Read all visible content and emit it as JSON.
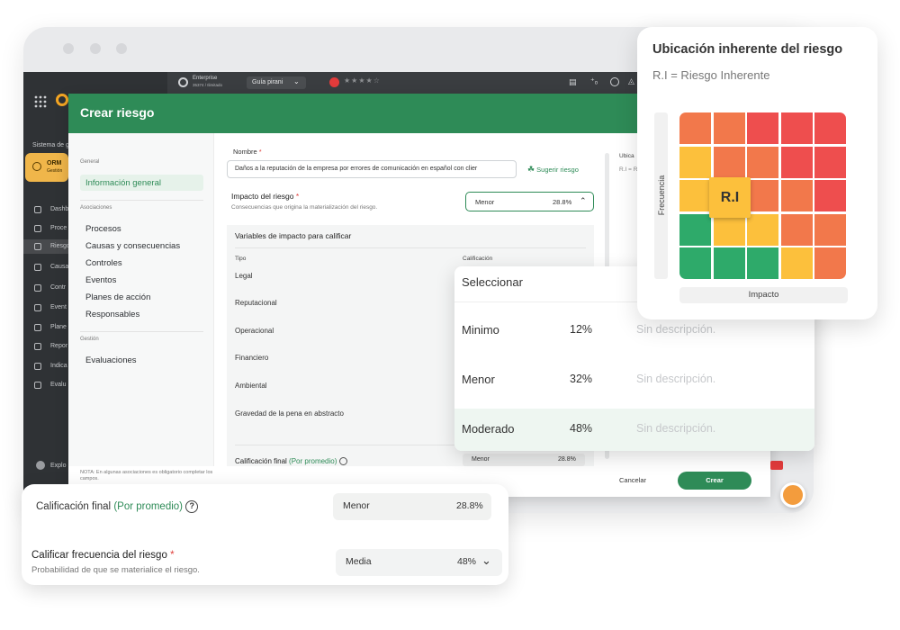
{
  "browser": {
    "topbar": {
      "plan_name": "Enterprise",
      "plan_detail": "35374 / Ilimitado",
      "dropdown_label": "Guía pirani",
      "rating_stars": "★★★★☆"
    }
  },
  "app_sidebar": {
    "section_label": "Sistema de g",
    "module_short": "ORM",
    "module_sub": "Gestión",
    "items": [
      {
        "label": "Dashb",
        "icon": "monitor-icon"
      },
      {
        "label": "Proce",
        "icon": "process-icon"
      },
      {
        "label": "Riesgo",
        "icon": "risk-icon"
      },
      {
        "label": "Causa",
        "icon": "cause-icon"
      },
      {
        "label": "Contr",
        "icon": "control-icon"
      },
      {
        "label": "Event",
        "icon": "warning-icon"
      },
      {
        "label": "Plane",
        "icon": "checklist-icon"
      },
      {
        "label": "Repor",
        "icon": "report-icon"
      },
      {
        "label": "Indica",
        "icon": "indicator-icon"
      },
      {
        "label": "Evalu",
        "icon": "evaluation-icon"
      }
    ],
    "footer_label": "Explo"
  },
  "modal": {
    "title": "Crear riesgo",
    "nav": {
      "general_label": "General",
      "active_item": "Información general",
      "associations_label": "Asociaciones",
      "association_items": [
        "Procesos",
        "Causas y consecuencias",
        "Controles",
        "Eventos",
        "Planes de acción",
        "Responsables"
      ],
      "management_label": "Gestión",
      "management_items": [
        "Evaluaciones"
      ],
      "note": "NOTA: En algunas asociaciones es obligatorio completar los campos."
    },
    "form": {
      "name_label": "Nombre",
      "required_mark": "*",
      "name_value": "Daños a la reputación de la empresa por errores de comunicación en español con clier",
      "suggest_label": "Sugerir riesgo",
      "impact_label": "Impacto del riesgo",
      "impact_help": "Consecuencias que origina la materialización del riesgo.",
      "impact_value": "Menor",
      "impact_pct": "28.8%",
      "variables_title": "Variables de impacto para calificar",
      "col_type": "Tipo",
      "col_rating": "Calificación",
      "rows": [
        "Legal",
        "Reputacional",
        "Operacional",
        "Financiero",
        "Ambiental",
        "Gravedad de la pena en abstracto"
      ],
      "final_label": "Calificación final",
      "final_method": "(Por promedio)",
      "final_value": "Menor",
      "final_pct": "28.8%"
    },
    "right_panel": {
      "title_partial": "Ubica",
      "sub_partial": "R.I = R"
    },
    "footer": {
      "cancel": "Cancelar",
      "create": "Crear"
    }
  },
  "select_dropdown": {
    "title": "Seleccionar",
    "options": [
      {
        "name": "Minimo",
        "pct": "12%",
        "desc": "Sin descripción."
      },
      {
        "name": "Menor",
        "pct": "32%",
        "desc": "Sin descripción."
      },
      {
        "name": "Moderado",
        "pct": "48%",
        "desc": "Sin descripción."
      }
    ],
    "highlighted_index": 2
  },
  "heatmap_card": {
    "title": "Ubicación inherente del riesgo",
    "subtitle": "R.I = Riesgo Inherente",
    "y_label": "Frecuencia",
    "x_label": "Impacto",
    "marker_label": "R.I",
    "marker_cell": {
      "row": 2,
      "col": 1
    },
    "colors": {
      "red": "#ee4e4e",
      "orange": "#f2784b",
      "yellow": "#fcc03c",
      "green": "#2eaa6a"
    },
    "grid": [
      [
        "orange",
        "orange",
        "red",
        "red",
        "red"
      ],
      [
        "yellow",
        "orange",
        "orange",
        "red",
        "red"
      ],
      [
        "yellow",
        "yellow",
        "orange",
        "orange",
        "red"
      ],
      [
        "green",
        "yellow",
        "yellow",
        "orange",
        "orange"
      ],
      [
        "green",
        "green",
        "green",
        "yellow",
        "orange"
      ]
    ]
  },
  "bottom_card": {
    "final_label": "Calificación final",
    "final_method": "(Por promedio)",
    "final_value": "Menor",
    "final_pct": "28.8%",
    "frequency_label": "Calificar frecuencia del riesgo",
    "required_mark": "*",
    "frequency_help": "Probabilidad de que se materialice el riesgo.",
    "frequency_value": "Media",
    "frequency_pct": "48%"
  },
  "theme": {
    "accent": "#2e8b57",
    "sidebar_bg": "#2f3235",
    "required": "#e0413e"
  }
}
